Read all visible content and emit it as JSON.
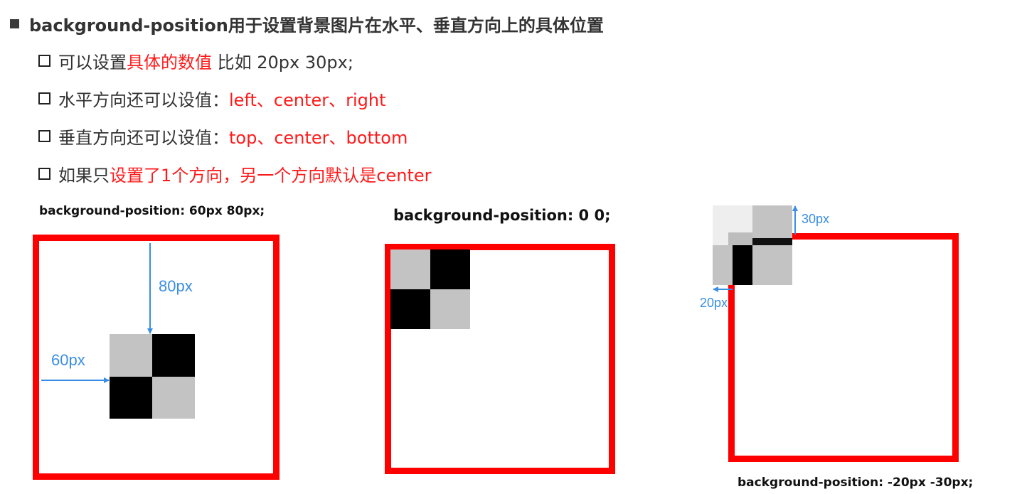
{
  "heading": {
    "text": "background-position用于设置背景图片在水平、垂直方向上的具体位置"
  },
  "bullets": [
    {
      "parts": [
        {
          "text": "可以设置",
          "color": "dark"
        },
        {
          "text": "具体的数值",
          "color": "red"
        },
        {
          "text": " 比如 20px 30px;",
          "color": "dark"
        }
      ]
    },
    {
      "parts": [
        {
          "text": "水平方向还可以设值：",
          "color": "dark"
        },
        {
          "text": "left、center、right",
          "color": "red"
        }
      ]
    },
    {
      "parts": [
        {
          "text": "垂直方向还可以设值：",
          "color": "dark"
        },
        {
          "text": "top、center、bottom",
          "color": "red"
        }
      ]
    },
    {
      "parts": [
        {
          "text": "如果只",
          "color": "dark"
        },
        {
          "text": "设置了1个方向，另一个方向默认是center",
          "color": "red"
        }
      ]
    }
  ],
  "examples": {
    "first": {
      "caption": "background-position: 60px 80px;",
      "x_label": "60px",
      "y_label": "80px"
    },
    "second": {
      "caption": "background-position: 0 0;"
    },
    "third": {
      "caption": "background-position: -20px -30px;",
      "x_label": "20px",
      "y_label": "30px"
    }
  },
  "colors": {
    "frame": "#ff0000",
    "accent_red": "#ff1a1a",
    "arrow_blue": "#3a8ee6",
    "tile_gray": "#c3c3c3",
    "tile_black": "#000000"
  }
}
